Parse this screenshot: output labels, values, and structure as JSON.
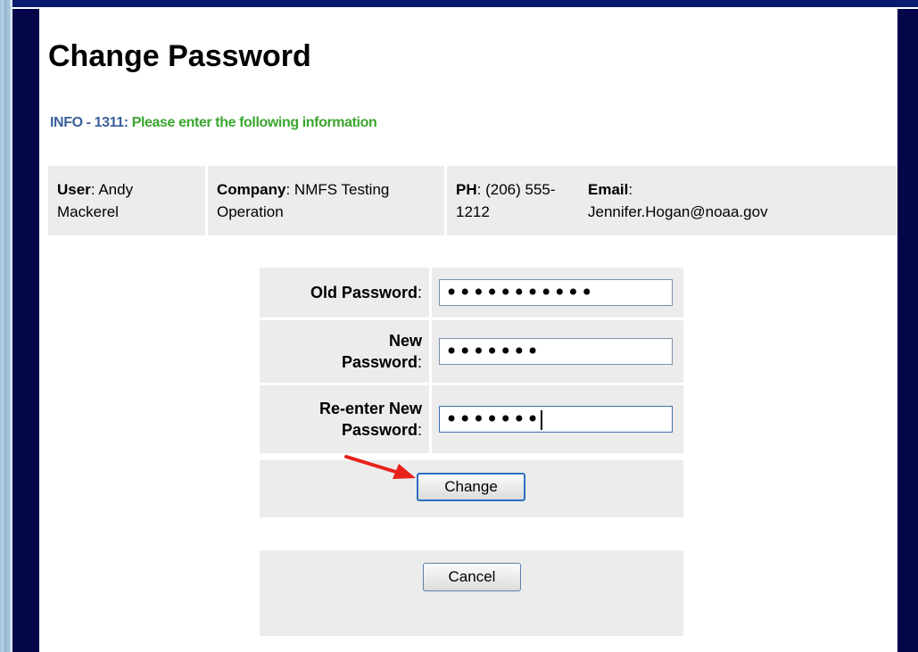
{
  "page": {
    "title": "Change Password",
    "info_code": "INFO - 1311:",
    "info_message": "Please enter the following information"
  },
  "user_info": {
    "user_label": "User",
    "user_value": "Andy Mackerel",
    "company_label": "Company",
    "company_value": "NMFS Testing Operation",
    "phone_label": "PH",
    "phone_value": "(206) 555-1212",
    "email_label": "Email",
    "email_value": "Jennifer.Hogan@noaa.gov"
  },
  "form": {
    "old_password_label": "Old Password",
    "old_password_value": "•••••••••••",
    "new_password_label_line1": "New",
    "new_password_label_line2": "Password",
    "new_password_value": "•••••••",
    "reenter_label_line1": "Re-enter New",
    "reenter_label_line2": "Password",
    "reenter_value": "•••••••",
    "colon": ":"
  },
  "buttons": {
    "change_label": "Change",
    "cancel_label": "Cancel"
  },
  "annotation": {
    "arrow_color": "#e8221b"
  },
  "colors": {
    "navy_border": "#05054a",
    "info_code": "#3a5f99",
    "info_message": "#3aa52e",
    "panel_bg": "#ececec"
  }
}
